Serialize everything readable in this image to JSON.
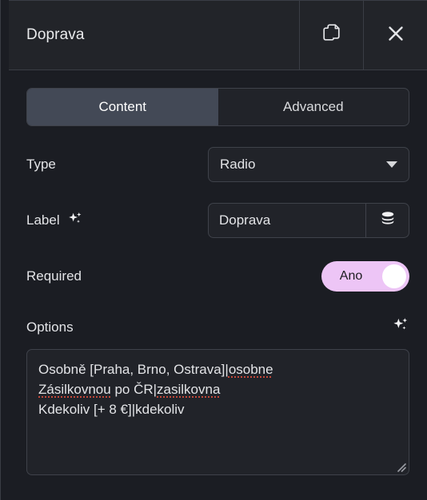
{
  "header": {
    "title": "Doprava",
    "duplicate_icon": "copy-icon",
    "close_icon": "close-icon"
  },
  "tabs": [
    {
      "label": "Content",
      "active": true
    },
    {
      "label": "Advanced",
      "active": false
    }
  ],
  "fields": {
    "type": {
      "label": "Type",
      "value": "Radio",
      "dropdown_icon": "chevron-down-icon"
    },
    "label": {
      "label": "Label",
      "sparkle_icon": "sparkles-icon",
      "value": "Doprava",
      "addon_icon": "database-icon"
    },
    "required": {
      "label": "Required",
      "toggle_text": "Ano",
      "enabled": true
    },
    "options": {
      "label": "Options",
      "sparkle_icon": "sparkles-icon",
      "lines": [
        {
          "segments": [
            {
              "text": "Osobně [Praha, Brno, Ostrava]|",
              "misspelled": false
            },
            {
              "text": "osobne",
              "misspelled": true
            }
          ]
        },
        {
          "segments": [
            {
              "text": "Zásilkovnou",
              "misspelled": true
            },
            {
              "text": " po ČR|",
              "misspelled": false
            },
            {
              "text": "zasilkovna",
              "misspelled": true
            }
          ]
        },
        {
          "segments": [
            {
              "text": "Kdekoliv [+ 8 €]|kdekoliv",
              "misspelled": false
            }
          ]
        }
      ],
      "raw_text": "Osobně [Praha, Brno, Ostrava]|osobne\nZásilkovnou po ČR|zasilkovna\nKdekoliv [+ 8 €]|kdekoliv",
      "resize_handle_icon": "resize-handle-icon"
    }
  },
  "colors": {
    "panel_bg": "#1b1d23",
    "header_bg": "#222429",
    "border": "#3a3d45",
    "control_bg": "#212329",
    "control_border": "#3f424a",
    "active_tab_bg": "#434956",
    "toggle_on": "#edc5f6",
    "toggle_knob": "#ffffff",
    "text": "#e3e4e7",
    "spellcheck_underline": "#c4483a"
  }
}
